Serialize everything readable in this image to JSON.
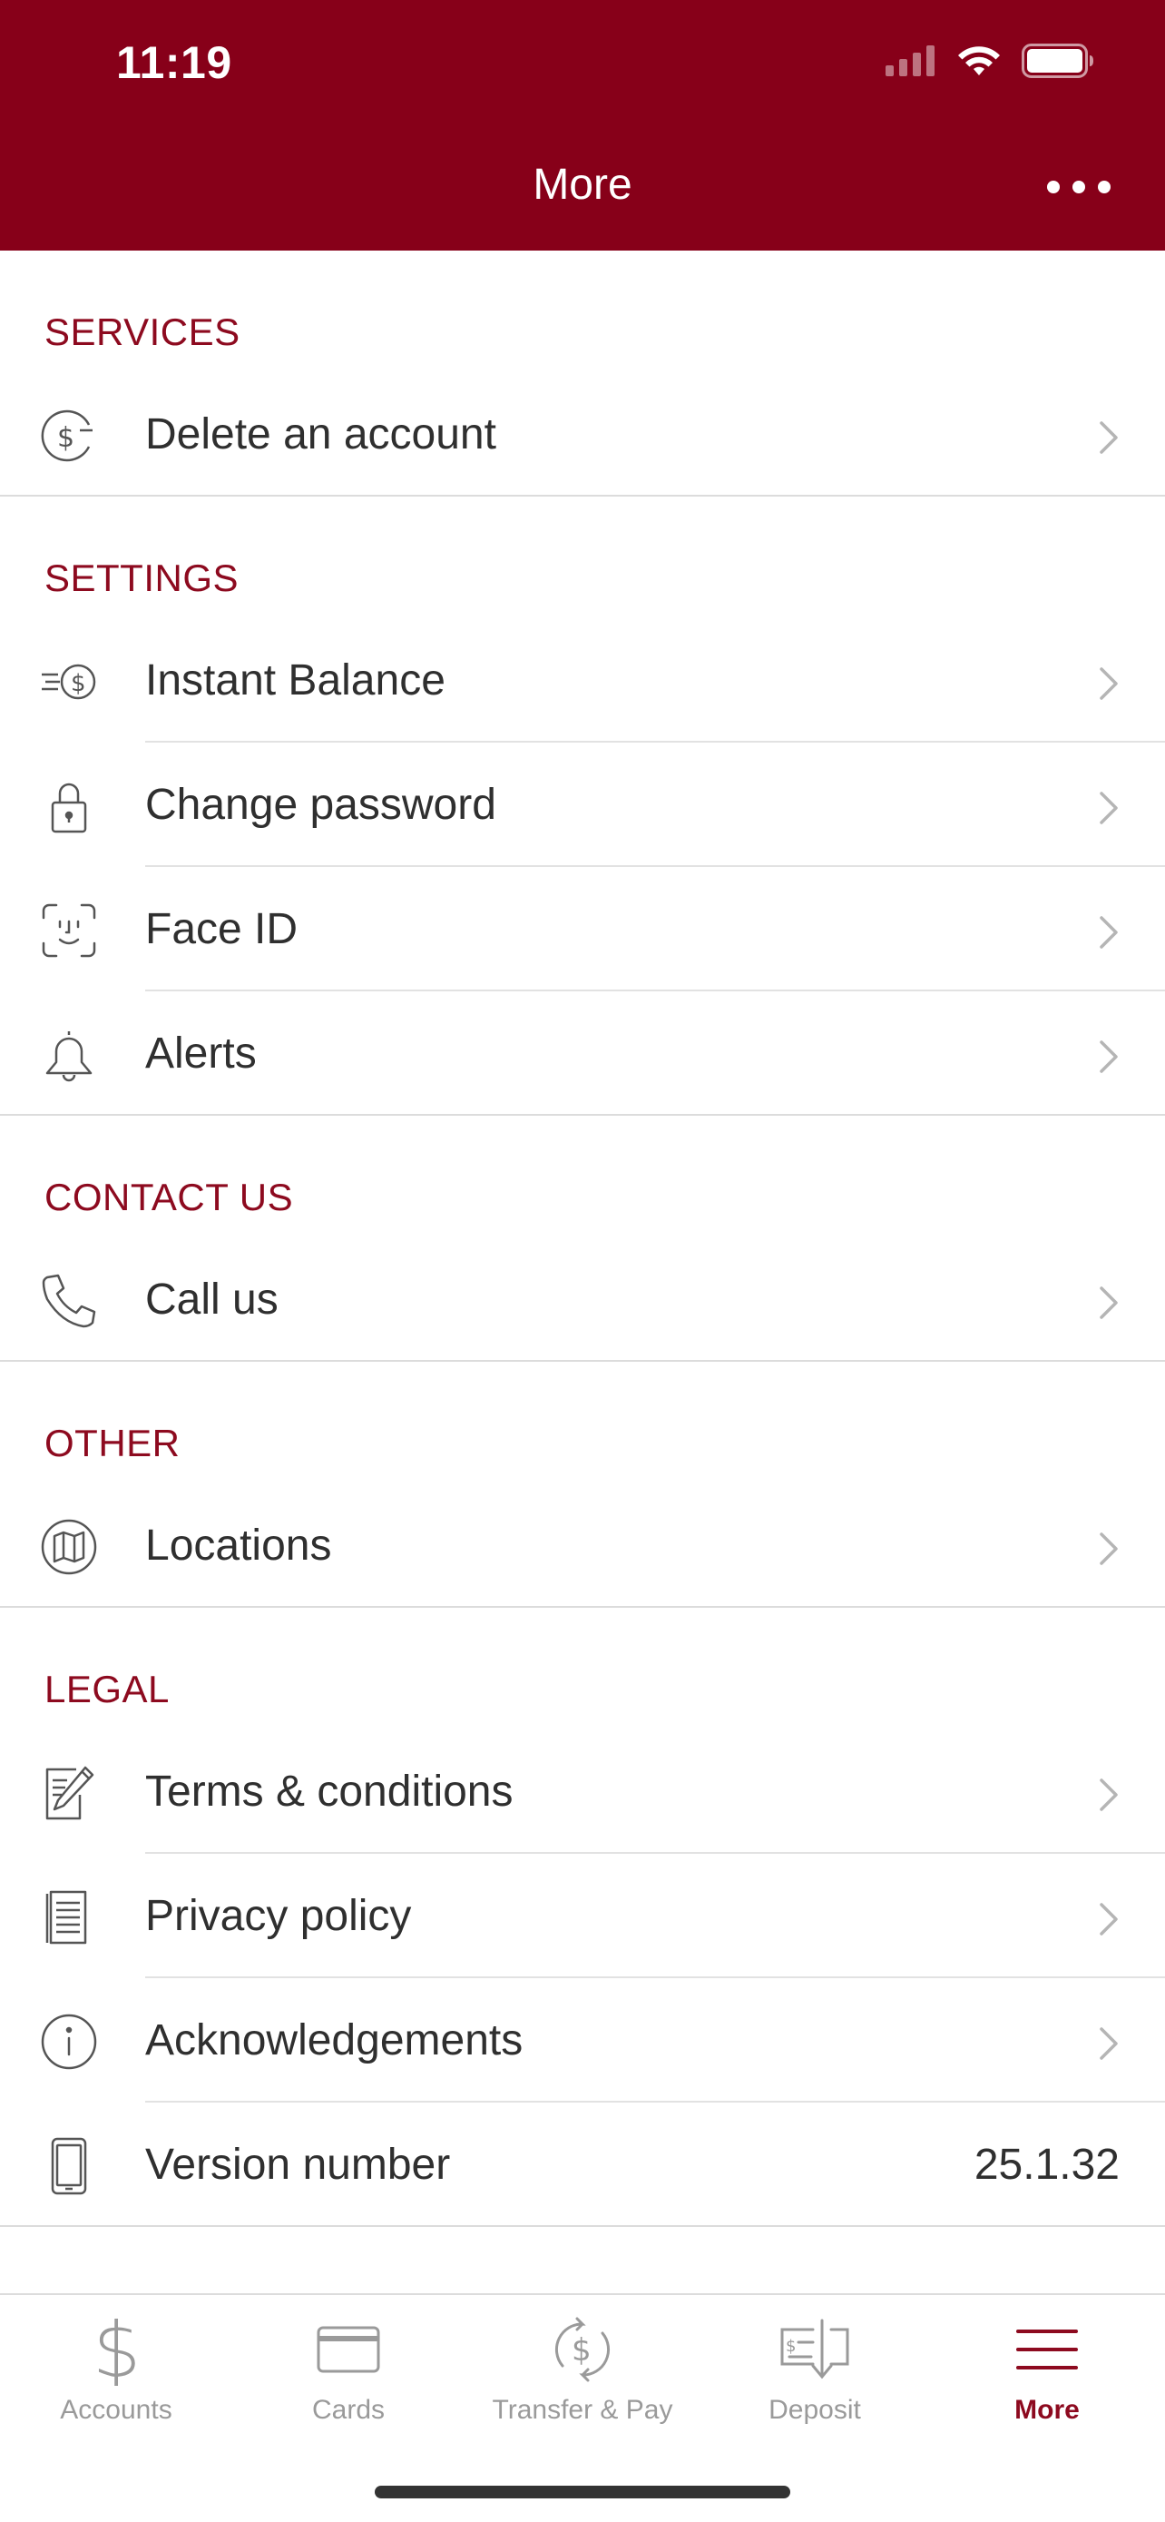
{
  "status_bar": {
    "time": "11:19"
  },
  "header": {
    "title": "More",
    "more_icon": "ellipsis-icon",
    "background": "#870019"
  },
  "sections": {
    "services": {
      "title": "SERVICES",
      "items": [
        {
          "label": "Delete an account",
          "icon": "dollar-minus-icon"
        }
      ]
    },
    "settings": {
      "title": "SETTINGS",
      "items": [
        {
          "label": "Instant Balance",
          "icon": "fast-dollar-icon"
        },
        {
          "label": "Change password",
          "icon": "lock-icon"
        },
        {
          "label": "Face ID",
          "icon": "face-id-icon"
        },
        {
          "label": "Alerts",
          "icon": "bell-icon"
        }
      ]
    },
    "contact": {
      "title": "CONTACT US",
      "items": [
        {
          "label": "Call us",
          "icon": "phone-icon"
        }
      ]
    },
    "other": {
      "title": "OTHER",
      "items": [
        {
          "label": "Locations",
          "icon": "map-icon"
        }
      ]
    },
    "legal": {
      "title": "LEGAL",
      "items": [
        {
          "label": "Terms & conditions",
          "icon": "document-pen-icon"
        },
        {
          "label": "Privacy policy",
          "icon": "receipt-icon"
        },
        {
          "label": "Acknowledgements",
          "icon": "info-icon"
        },
        {
          "label": "Version number",
          "icon": "phone-device-icon",
          "value": "25.1.32"
        }
      ]
    }
  },
  "tabbar": {
    "tabs": [
      {
        "label": "Accounts",
        "icon": "dollar-icon"
      },
      {
        "label": "Cards",
        "icon": "card-icon"
      },
      {
        "label": "Transfer & Pay",
        "icon": "transfer-icon"
      },
      {
        "label": "Deposit",
        "icon": "check-deposit-icon"
      },
      {
        "label": "More",
        "icon": "hamburger-icon",
        "active": true
      }
    ]
  },
  "colors": {
    "accent": "#870019",
    "section_title": "#8d0a1f",
    "inactive_tab": "#9a9a9a"
  }
}
